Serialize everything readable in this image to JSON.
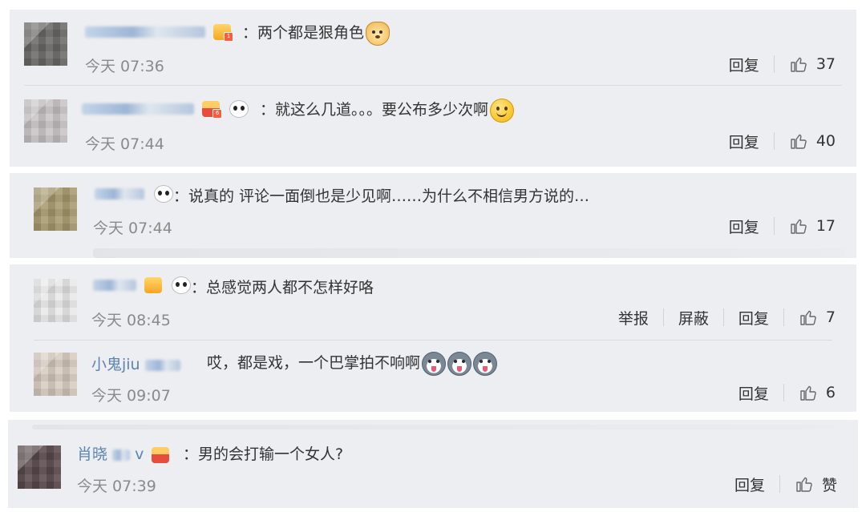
{
  "comments": [
    {
      "id": "c1",
      "badge": "vip",
      "text": "两个都是狠角色",
      "emoji": "dog-emoji",
      "time": "今天 07:36",
      "reply_label": "回复",
      "likes": "37"
    },
    {
      "id": "c2",
      "badge": "vip",
      "text": "就这么几道。。。要公布多少次啊",
      "emoji": "smile-emoji",
      "time": "今天 07:44",
      "reply_label": "回复",
      "likes": "40"
    },
    {
      "id": "c3",
      "text": "说真的 评论一面倒也是少见啊……为什么不相信男方说的…",
      "time": "今天 07:44",
      "reply_label": "回复",
      "likes": "17"
    },
    {
      "id": "c4",
      "text": "总感觉两人都不怎样好咯",
      "time": "今天 08:45",
      "report_label": "举报",
      "block_label": "屏蔽",
      "reply_label": "回复",
      "likes": "7"
    },
    {
      "id": "c5",
      "name": "小鬼jiu",
      "text": "哎，都是戏，一个巴掌拍不响啊",
      "emoji": "husky-emoji",
      "time": "今天 09:07",
      "reply_label": "回复",
      "likes": "6"
    },
    {
      "id": "c6",
      "name": "肖晓",
      "name_suffix": "v",
      "text": "男的会打输一个女人?",
      "time": "今天 07:39",
      "reply_label": "回复",
      "likes": "赞"
    }
  ],
  "colors": {
    "card_bg": "#eceef1",
    "name_link": "#5b84b3",
    "time_gray": "#8a8a8a"
  }
}
